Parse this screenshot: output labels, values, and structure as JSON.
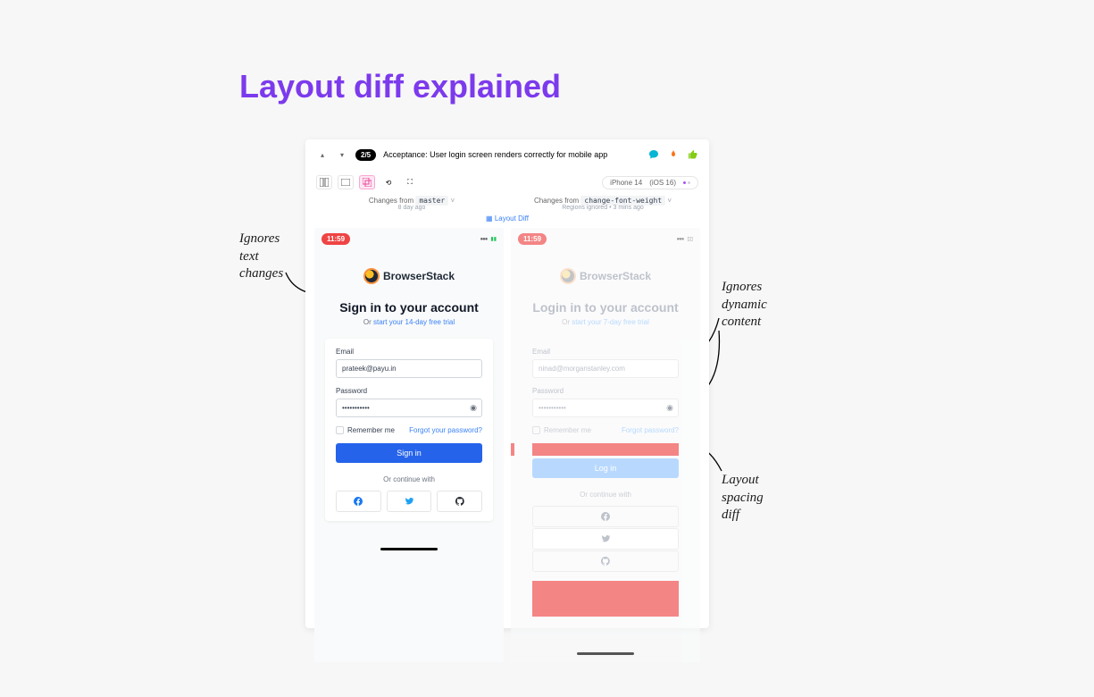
{
  "title": "Layout diff explained",
  "annotations": {
    "text_changes": "Ignores\ntext\nchanges",
    "dynamic_content": "Ignores\ndynamic\ncontent",
    "spacing": "Layout\nspacing\ndiff"
  },
  "panel": {
    "counter": "2/5",
    "test_name": "Acceptance: User login screen renders correctly for mobile app",
    "device": {
      "name": "iPhone 14",
      "os": "(iOS 16)"
    },
    "changes_left_prefix": "Changes from ",
    "changes_left_branch": "master",
    "changes_right_prefix": "Changes from ",
    "changes_right_branch": "change-font-weight",
    "meta_left": "8 day ago",
    "meta_right": "Regions ignored • 3 mins ago",
    "layout_diff": "Layout Diff"
  },
  "left": {
    "time": "11:59",
    "brand": "BrowserStack",
    "headline": "Sign in to your account",
    "sub_prefix": "Or ",
    "sub_link": "start your 14-day free trial",
    "email_label": "Email",
    "email_value": "prateek@payu.in",
    "password_label": "Password",
    "password_value": "•••••••••••",
    "remember": "Remember me",
    "forgot": "Forgot your password?",
    "signin": "Sign in",
    "continue": "Or continue with"
  },
  "right": {
    "time": "11:59",
    "brand": "BrowserStack",
    "headline": "Login in to your account",
    "sub_prefix": "Or ",
    "sub_link": "start your 7-day free trial",
    "email_label": "Email",
    "email_value": "ninad@morganstanley.com",
    "password_label": "Password",
    "password_value": "•••••••••••",
    "remember": "Remember me",
    "forgot": "Forgot password?",
    "signin": "Log in",
    "continue": "Or continue with"
  }
}
